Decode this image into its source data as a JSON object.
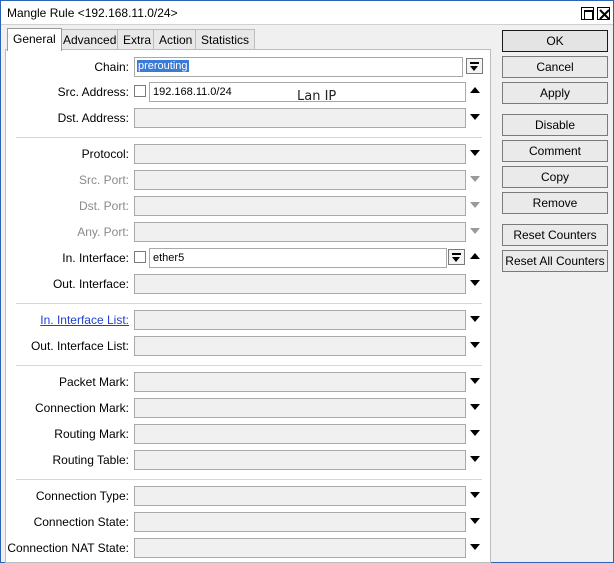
{
  "window": {
    "title": "Mangle Rule <192.168.11.0/24>"
  },
  "tabs": [
    {
      "label": "General",
      "active": true
    },
    {
      "label": "Advanced"
    },
    {
      "label": "Extra"
    },
    {
      "label": "Action"
    },
    {
      "label": "Statistics"
    }
  ],
  "fields": {
    "chain": {
      "label": "Chain:",
      "value": "prerouting"
    },
    "src_address": {
      "label": "Src. Address:",
      "value": "192.168.11.0/24"
    },
    "dst_address": {
      "label": "Dst. Address:"
    },
    "protocol": {
      "label": "Protocol:"
    },
    "src_port": {
      "label": "Src. Port:"
    },
    "dst_port": {
      "label": "Dst. Port:"
    },
    "any_port": {
      "label": "Any. Port:"
    },
    "in_interface": {
      "label": "In. Interface:",
      "value": "ether5"
    },
    "out_interface": {
      "label": "Out. Interface:"
    },
    "in_interface_list": {
      "label": "In. Interface List:"
    },
    "out_interface_list": {
      "label": "Out. Interface List:"
    },
    "packet_mark": {
      "label": "Packet Mark:"
    },
    "connection_mark": {
      "label": "Connection Mark:"
    },
    "routing_mark": {
      "label": "Routing Mark:"
    },
    "routing_table": {
      "label": "Routing Table:"
    },
    "connection_type": {
      "label": "Connection Type:"
    },
    "connection_state": {
      "label": "Connection State:"
    },
    "connection_nat_state": {
      "label": "Connection NAT State:"
    }
  },
  "annotation": "Lan IP",
  "buttons": {
    "ok": "OK",
    "cancel": "Cancel",
    "apply": "Apply",
    "disable": "Disable",
    "comment": "Comment",
    "copy": "Copy",
    "remove": "Remove",
    "reset_counters": "Reset Counters",
    "reset_all_counters": "Reset All Counters"
  },
  "colors": {
    "selection": "#3a7bd5",
    "link_label": "#1f3fd0",
    "window_border": "#2b63b5"
  }
}
